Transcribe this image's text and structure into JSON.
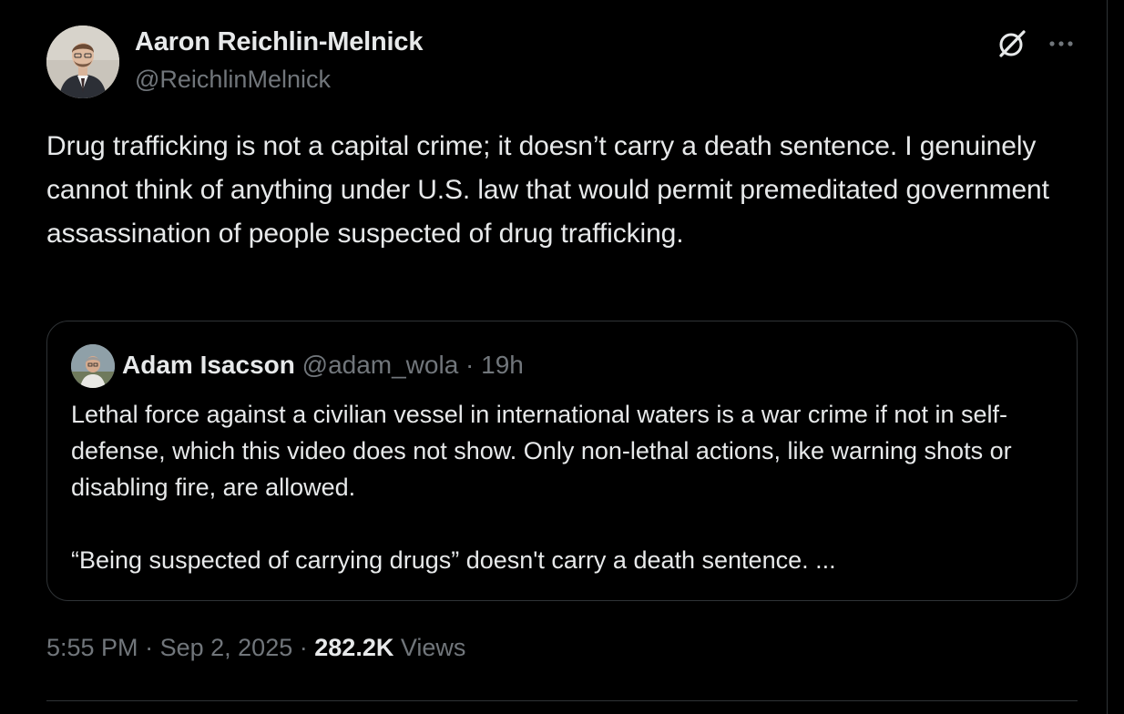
{
  "author": {
    "display_name": "Aaron Reichlin-Melnick",
    "handle": "@ReichlinMelnick"
  },
  "header_icons": {
    "grok": "grok-icon",
    "more": "more-icon"
  },
  "tweet": {
    "text": "Drug trafficking is not a capital crime; it doesn’t carry a death sentence. I genuinely cannot think of anything under U.S. law that would permit premeditated government assassination of people suspected of drug trafficking."
  },
  "quoted_tweet": {
    "display_name": "Adam Isacson",
    "handle": "@adam_wola",
    "separator": "·",
    "time": "19h",
    "paragraph_1": "Lethal force against a civilian vessel in international waters is a war crime if not in self-defense, which this video does not show. Only non-lethal actions, like warning shots or disabling fire, are allowed.",
    "paragraph_2": "“Being suspected of carrying drugs” doesn't carry a death sentence. ..."
  },
  "meta": {
    "time": "5:55 PM",
    "separator": "·",
    "date": "Sep 2, 2025",
    "views_count": "282.2K",
    "views_label": "Views"
  },
  "colors": {
    "background": "#000000",
    "text_primary": "#e7e9ea",
    "text_secondary": "#71767b",
    "border": "#2f3336"
  }
}
